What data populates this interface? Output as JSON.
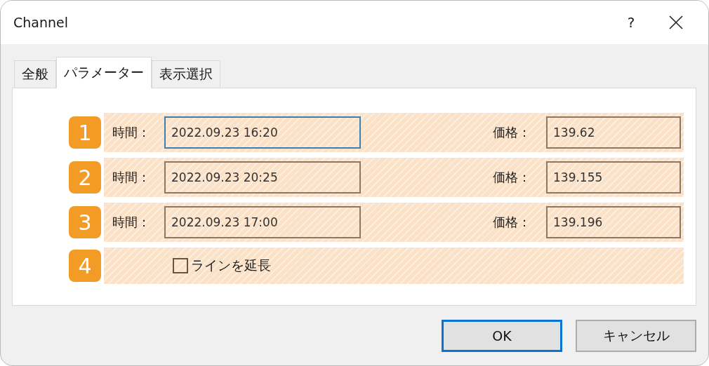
{
  "window": {
    "title": "Channel",
    "help": "?"
  },
  "tabs": [
    {
      "label": "全般",
      "selected": false
    },
    {
      "label": "パラメーター",
      "selected": true
    },
    {
      "label": "表示選択",
      "selected": false
    }
  ],
  "rows": [
    {
      "kind": "fields",
      "badge": "1",
      "time_label": "時間：",
      "time": "2022.09.23 16:20",
      "time_focused": true,
      "price_label": "価格：",
      "price": "139.62"
    },
    {
      "kind": "fields",
      "badge": "2",
      "time_label": "時間：",
      "time": "2022.09.23 20:25",
      "time_focused": false,
      "price_label": "価格：",
      "price": "139.155"
    },
    {
      "kind": "fields",
      "badge": "3",
      "time_label": "時間：",
      "time": "2022.09.23 17:00",
      "time_focused": false,
      "price_label": "価格：",
      "price": "139.196"
    },
    {
      "kind": "checkbox",
      "badge": "4",
      "label": "ラインを延長",
      "checked": false
    }
  ],
  "buttons": [
    {
      "label": "OK",
      "default": true
    },
    {
      "label": "キャンセル",
      "default": false
    }
  ]
}
